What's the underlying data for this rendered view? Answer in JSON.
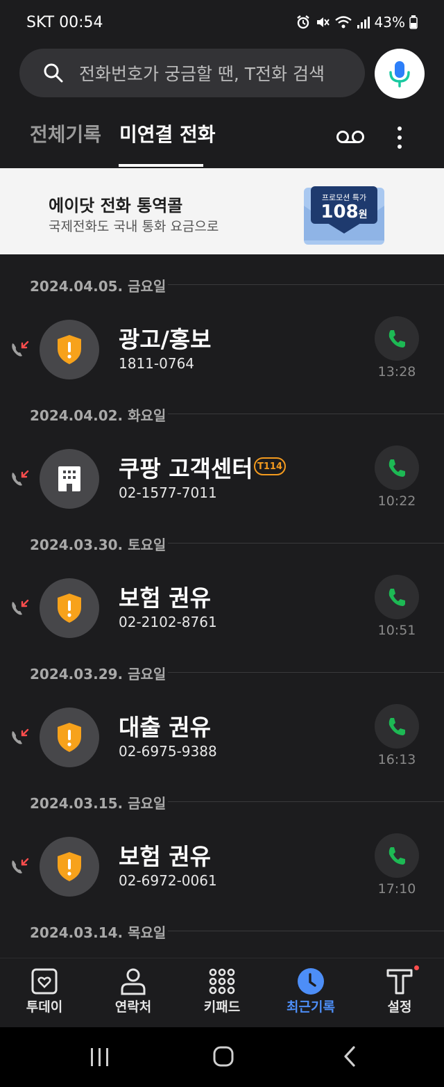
{
  "status_bar": {
    "carrier": "SKT",
    "time": "00:54",
    "battery": "43%"
  },
  "search": {
    "placeholder": "전화번호가 궁금할 땐, T전화 검색"
  },
  "tabs": [
    {
      "label": "전체기록",
      "active": false
    },
    {
      "label": "미연결 전화",
      "active": true
    }
  ],
  "banner": {
    "title": "에이닷 전화 통역콜",
    "subtitle": "국제전화도 국내 통화 요금으로",
    "graphic_label": "프로모션 특가",
    "graphic_price": "108",
    "graphic_unit": "원"
  },
  "groups": [
    {
      "date": "2024.04.05. 금요일",
      "name": "광고/홍보",
      "number": "1811-0764",
      "time": "13:28",
      "icon": "warning-shield-icon"
    },
    {
      "date": "2024.04.02. 화요일",
      "name": "쿠팡 고객센터",
      "badge": "T114",
      "number": "02-1577-7011",
      "time": "10:22",
      "icon": "building-icon"
    },
    {
      "date": "2024.03.30. 토요일",
      "name": "보험 권유",
      "number": "02-2102-8761",
      "time": "10:51",
      "icon": "warning-shield-icon"
    },
    {
      "date": "2024.03.29. 금요일",
      "name": "대출 권유",
      "number": "02-6975-9388",
      "time": "16:13",
      "icon": "warning-shield-icon"
    },
    {
      "date": "2024.03.15. 금요일",
      "name": "보험 권유",
      "number": "02-6972-0061",
      "time": "17:10",
      "icon": "warning-shield-icon"
    },
    {
      "date": "2024.03.14. 목요일"
    }
  ],
  "bottom_nav": [
    {
      "label": "투데이",
      "icon": "today-icon",
      "active": false
    },
    {
      "label": "연락처",
      "icon": "contacts-icon",
      "active": false
    },
    {
      "label": "키패드",
      "icon": "keypad-icon",
      "active": false
    },
    {
      "label": "최근기록",
      "icon": "recent-clock-icon",
      "active": true
    },
    {
      "label": "설정",
      "icon": "t-settings-icon",
      "active": false
    }
  ],
  "colors": {
    "accent_blue": "#4d8ef7",
    "call_green": "#1db954",
    "warning_orange": "#f39a1e",
    "missed_red": "#ff4d4d"
  }
}
